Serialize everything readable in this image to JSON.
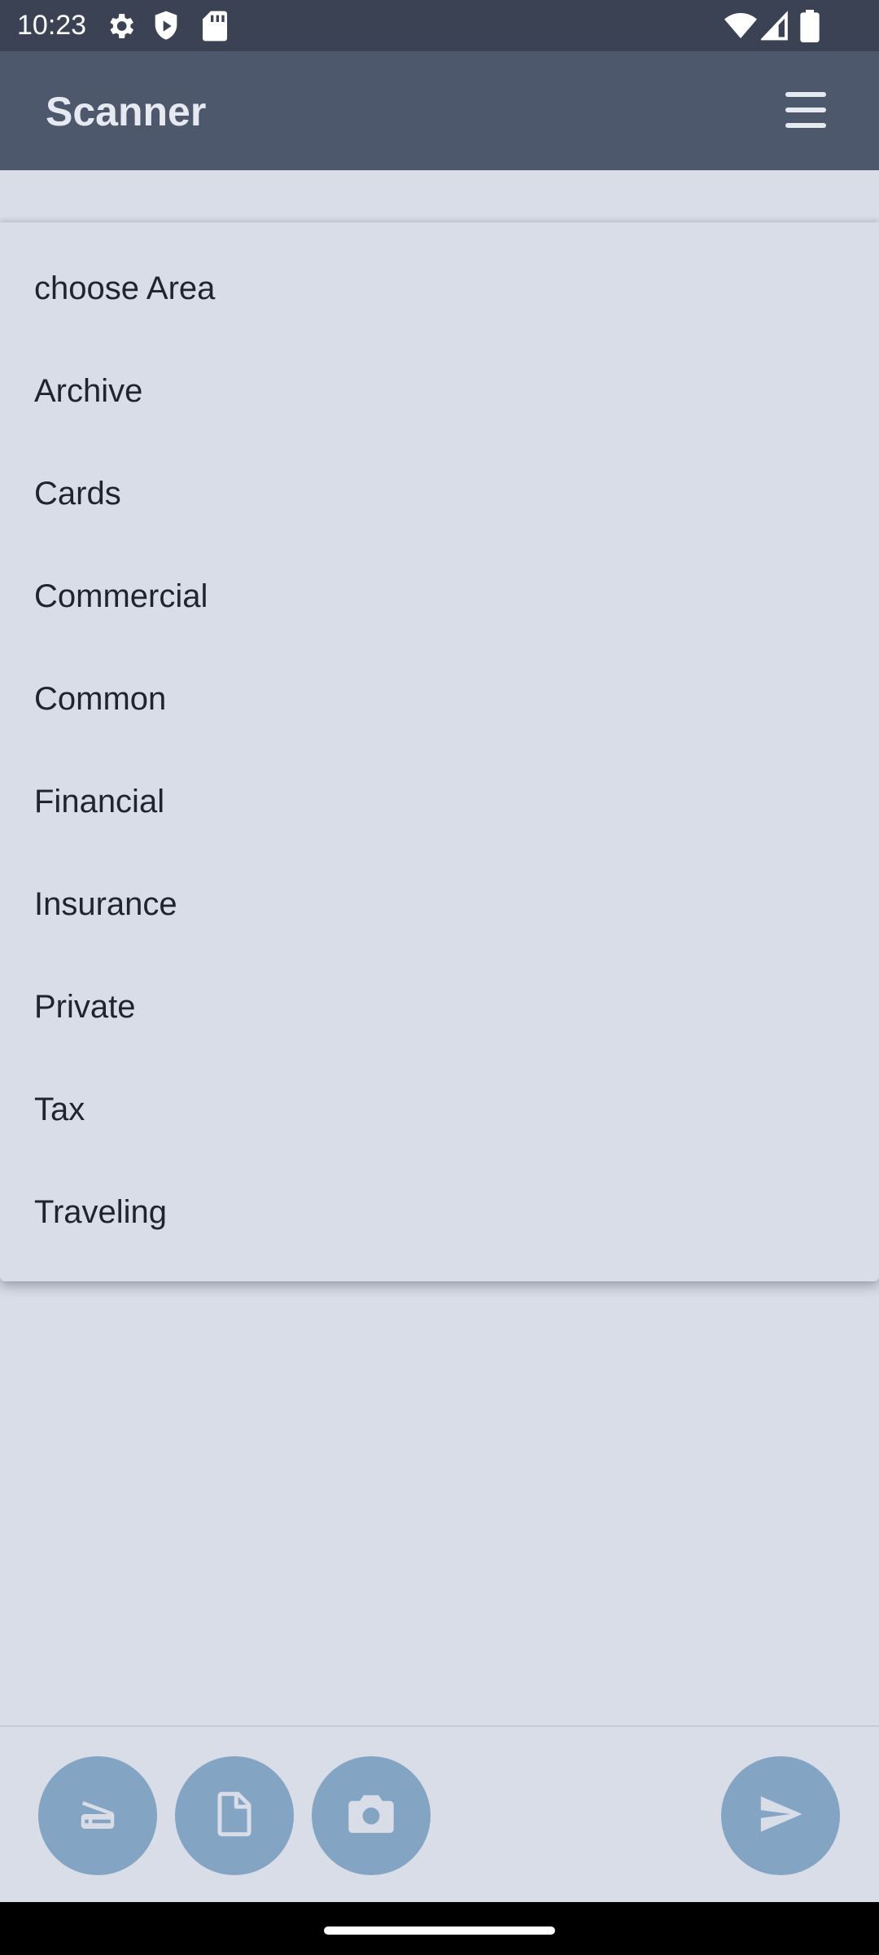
{
  "status_bar": {
    "time": "10:23",
    "icons": [
      "gear-icon",
      "shield-icon",
      "sd-card-icon",
      "wifi-icon",
      "signal-icon",
      "battery-icon"
    ]
  },
  "app_bar": {
    "title": "Scanner",
    "menu_icon": "hamburger-menu-icon"
  },
  "dropdown": {
    "items": [
      {
        "label": "choose Area"
      },
      {
        "label": "Archive"
      },
      {
        "label": "Cards"
      },
      {
        "label": "Commercial"
      },
      {
        "label": "Common"
      },
      {
        "label": "Financial"
      },
      {
        "label": "Insurance"
      },
      {
        "label": "Private"
      },
      {
        "label": "Tax"
      },
      {
        "label": "Traveling"
      }
    ]
  },
  "bottom_bar": {
    "buttons": [
      "scanner-icon",
      "document-icon",
      "camera-icon",
      "send-icon"
    ]
  },
  "colors": {
    "status_bar": "#3a4254",
    "app_bar": "#4d586d",
    "background": "#d8dde8",
    "fab": "#84a4c3"
  }
}
